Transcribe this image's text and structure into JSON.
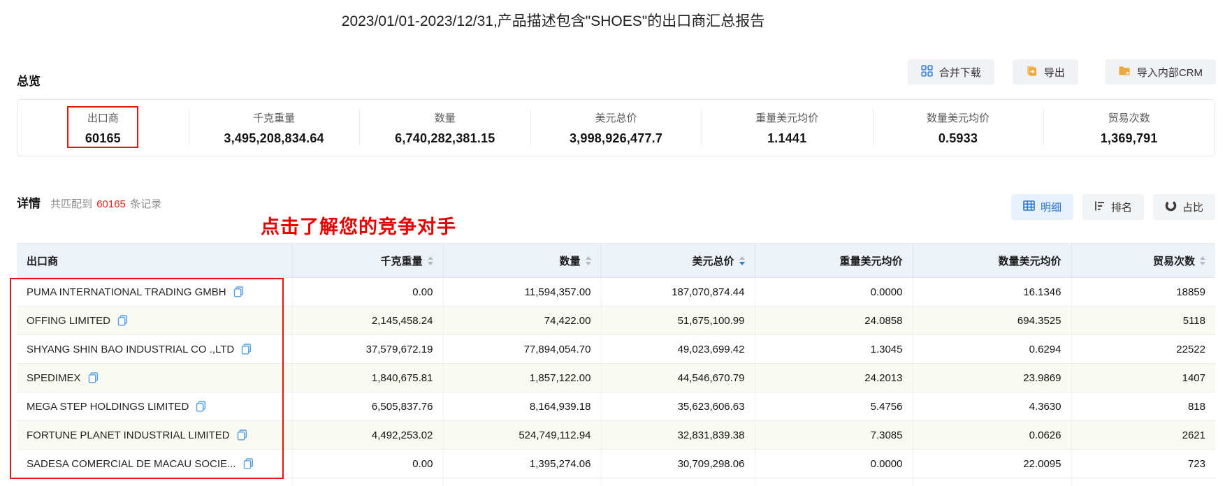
{
  "page_title": "2023/01/01-2023/12/31,产品描述包含\"SHOES\"的出口商汇总报告",
  "toolbar": {
    "buttons": [
      {
        "label": "合并下载",
        "icon": "merge-download-icon"
      },
      {
        "label": "导出",
        "icon": "export-doc-icon"
      },
      {
        "label": "导入内部CRM",
        "icon": "import-folder-icon"
      }
    ]
  },
  "overview": {
    "heading": "总览",
    "stats": [
      {
        "label": "出口商",
        "value": "60165"
      },
      {
        "label": "千克重量",
        "value": "3,495,208,834.64"
      },
      {
        "label": "数量",
        "value": "6,740,282,381.15"
      },
      {
        "label": "美元总价",
        "value": "3,998,926,477.7"
      },
      {
        "label": "重量美元均价",
        "value": "1.1441"
      },
      {
        "label": "数量美元均价",
        "value": "0.5933"
      },
      {
        "label": "贸易次数",
        "value": "1,369,791"
      }
    ]
  },
  "detail": {
    "heading": "详情",
    "records_prefix": "共匹配到",
    "records_count": "60165",
    "records_suffix": "条记录",
    "annotation_text": "点击了解您的竞争对手",
    "views": [
      {
        "label": "明细",
        "icon": "table-grid-icon",
        "active": true
      },
      {
        "label": "排名",
        "icon": "ranking-icon",
        "active": false
      },
      {
        "label": "占比",
        "icon": "pie-icon",
        "active": false
      }
    ]
  },
  "table": {
    "columns": [
      {
        "label": "出口商",
        "sortable": false
      },
      {
        "label": "千克重量",
        "sortable": true
      },
      {
        "label": "数量",
        "sortable": true
      },
      {
        "label": "美元总价",
        "sortable": true,
        "sort": "desc"
      },
      {
        "label": "重量美元均价",
        "sortable": false
      },
      {
        "label": "数量美元均价",
        "sortable": false
      },
      {
        "label": "贸易次数",
        "sortable": true
      }
    ],
    "rows": [
      [
        "PUMA INTERNATIONAL TRADING GMBH",
        "0.00",
        "11,594,357.00",
        "187,070,874.44",
        "0.0000",
        "16.1346",
        "18859"
      ],
      [
        "OFFING LIMITED",
        "2,145,458.24",
        "74,422.00",
        "51,675,100.99",
        "24.0858",
        "694.3525",
        "5118"
      ],
      [
        "SHYANG SHIN BAO INDUSTRIAL CO .,LTD",
        "37,579,672.19",
        "77,894,054.70",
        "49,023,699.42",
        "1.3045",
        "0.6294",
        "22522"
      ],
      [
        "SPEDIMEX",
        "1,840,675.81",
        "1,857,122.00",
        "44,546,670.79",
        "24.2013",
        "23.9869",
        "1407"
      ],
      [
        "MEGA STEP HOLDINGS LIMITED",
        "6,505,837.76",
        "8,164,939.18",
        "35,623,606.63",
        "5.4756",
        "4.3630",
        "818"
      ],
      [
        "FORTUNE PLANET INDUSTRIAL LIMITED",
        "4,492,253.02",
        "524,749,112.94",
        "32,831,839.38",
        "7.3085",
        "0.0626",
        "2621"
      ],
      [
        "SADESA COMERCIAL DE MACAU SOCIE...",
        "0.00",
        "1,395,274.06",
        "30,709,298.06",
        "0.0000",
        "22.0095",
        "723"
      ]
    ]
  },
  "colors": {
    "accent_blue": "#3077d2",
    "accent_orange": "#eda93c",
    "annotation_red": "#e8150b",
    "count_red": "#e02419",
    "table_header_bg": "#edf1f8",
    "alt_row_bg": "#f9faf1",
    "active_tab_bg": "#e7f1fc"
  }
}
